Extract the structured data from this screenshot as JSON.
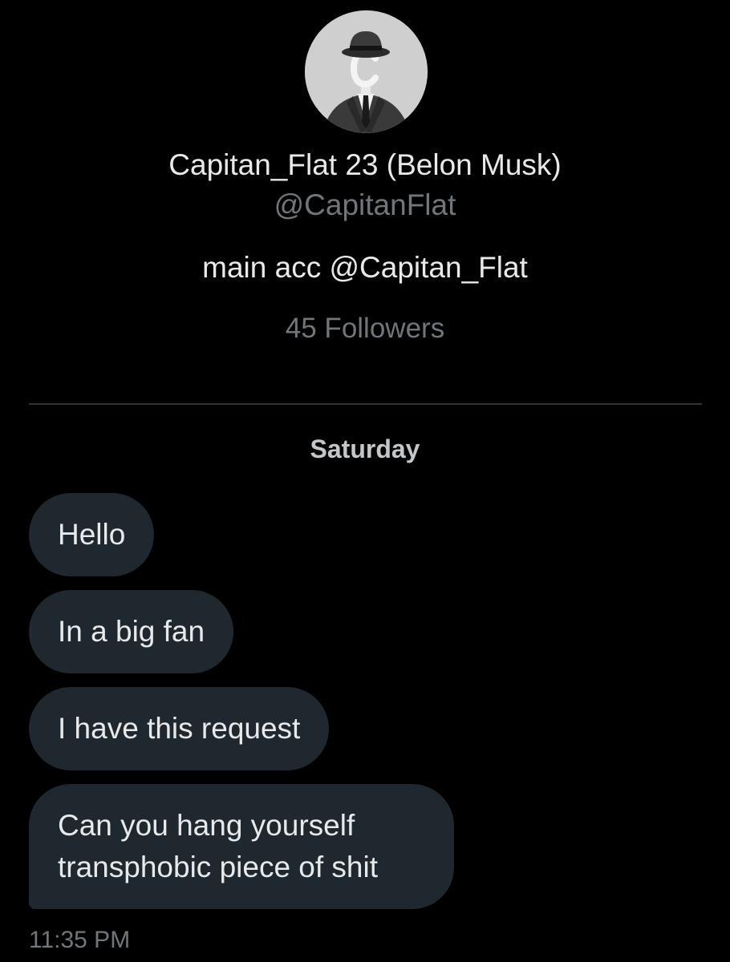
{
  "profile": {
    "display_name": "Capitan_Flat 23 (Belon Musk)",
    "handle": "@CapitanFlat",
    "bio": "main acc @Capitan_Flat",
    "followers": "45 Followers",
    "avatar_icon": "fedora-man-avatar"
  },
  "conversation": {
    "day_label": "Saturday",
    "messages": [
      {
        "text": "Hello"
      },
      {
        "text": "In a big fan"
      },
      {
        "text": "I have this request"
      },
      {
        "text": "Can you hang yourself transphobic piece of shit"
      }
    ],
    "timestamp": "11:35 PM"
  },
  "colors": {
    "background": "#000000",
    "bubble": "#1f282f",
    "primary_text": "#e7e9ea",
    "secondary_text": "#71767b",
    "divider": "#2f3336"
  }
}
